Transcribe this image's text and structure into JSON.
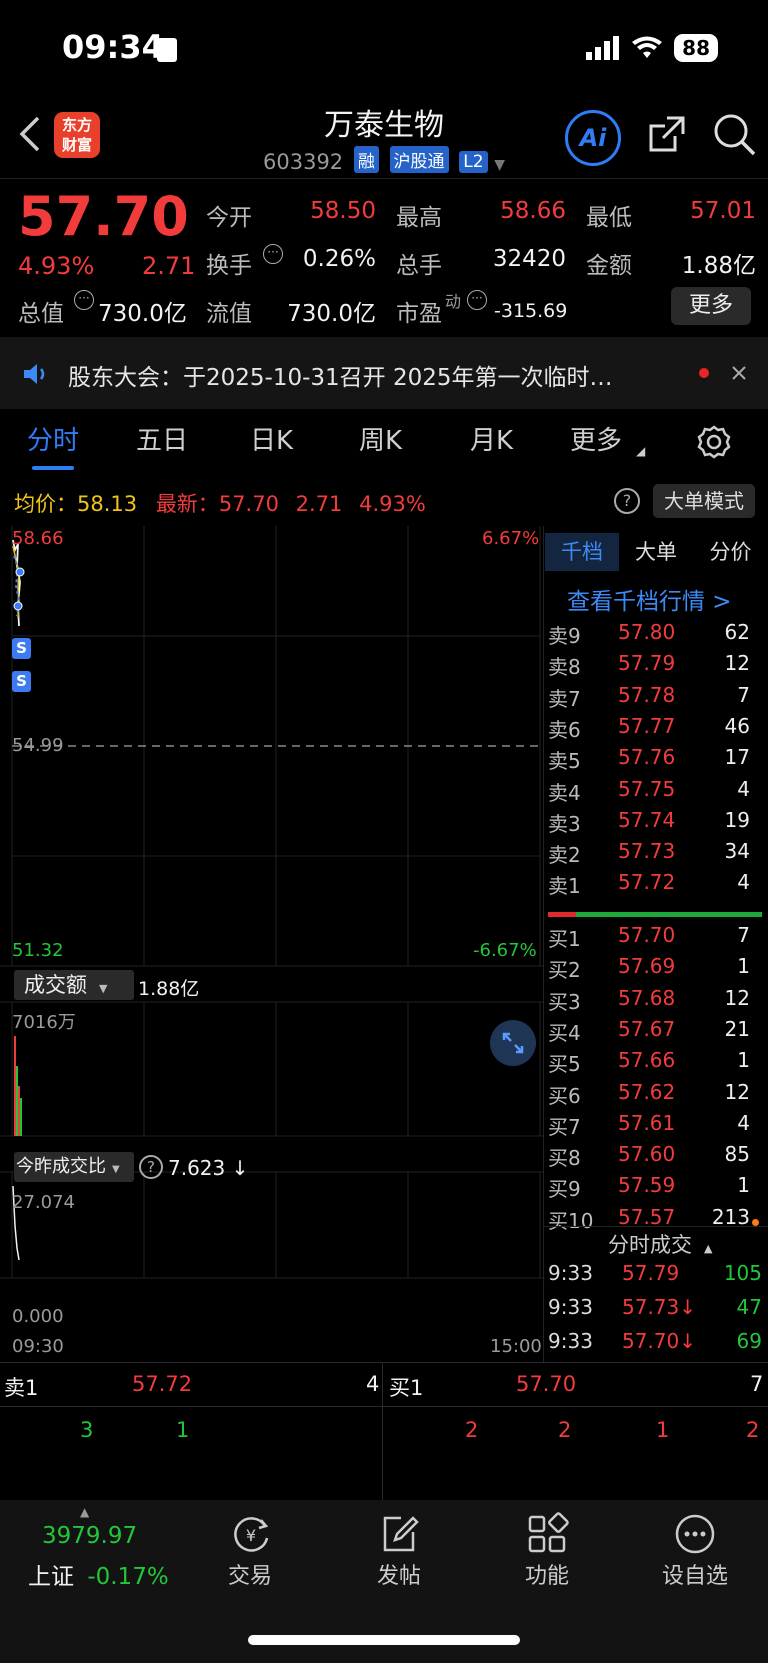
{
  "status_bar": {
    "time": "09:34",
    "battery": "88"
  },
  "header": {
    "logo_line1": "东方",
    "logo_line2": "财富",
    "title": "万泰生物",
    "code": "603392",
    "tags": [
      "融",
      "沪股通",
      "L2"
    ],
    "ai_label": "Ai"
  },
  "quote": {
    "price": "57.70",
    "change_pct": "4.93%",
    "change": "2.71",
    "open_label": "今开",
    "open": "58.50",
    "high_label": "最高",
    "high": "58.66",
    "low_label": "最低",
    "low": "57.01",
    "turnover_label": "换手",
    "turnover": "0.26%",
    "volume_label": "总手",
    "volume": "32420",
    "amount_label": "金额",
    "amount": "1.88亿",
    "mcap_label": "总值",
    "mcap": "730.0亿",
    "float_label": "流值",
    "float_cap": "730.0亿",
    "pe_label": "市盈",
    "pe_sup": "动",
    "pe": "-315.69",
    "more_label": "更多"
  },
  "notice": {
    "text": "股东大会：于2025-10-31召开 2025年第一次临时…"
  },
  "tabs": [
    "分时",
    "五日",
    "日K",
    "周K",
    "月K",
    "更多"
  ],
  "avg_row": {
    "avg_label": "均价：",
    "avg": "58.13",
    "latest_label": "最新：",
    "latest": "57.70",
    "change": "2.71",
    "change_pct": "4.93%",
    "mode_button": "大单模式"
  },
  "chart": {
    "price_top": "58.66",
    "pct_top": "6.67%",
    "price_mid": "54.99",
    "price_bottom": "51.32",
    "pct_bottom": "-6.67%",
    "amount_label": "成交额",
    "amount_total": "1.88亿",
    "amount_max": "7016万",
    "ratio_label": "今昨成交比",
    "ratio_value": "7.623 ↓",
    "ratio_max": "27.074",
    "ratio_min": "0.000",
    "time_start": "09:30",
    "time_end": "15:00",
    "marker": "S"
  },
  "orderbook": {
    "tabs": [
      "千档",
      "大单",
      "分价"
    ],
    "link": "查看千档行情 >",
    "asks": [
      {
        "name": "卖9",
        "price": "57.80",
        "vol": "62"
      },
      {
        "name": "卖8",
        "price": "57.79",
        "vol": "12"
      },
      {
        "name": "卖7",
        "price": "57.78",
        "vol": "7"
      },
      {
        "name": "卖6",
        "price": "57.77",
        "vol": "46"
      },
      {
        "name": "卖5",
        "price": "57.76",
        "vol": "17"
      },
      {
        "name": "卖4",
        "price": "57.75",
        "vol": "4"
      },
      {
        "name": "卖3",
        "price": "57.74",
        "vol": "19"
      },
      {
        "name": "卖2",
        "price": "57.73",
        "vol": "34"
      },
      {
        "name": "卖1",
        "price": "57.72",
        "vol": "4"
      }
    ],
    "bids": [
      {
        "name": "买1",
        "price": "57.70",
        "vol": "7"
      },
      {
        "name": "买2",
        "price": "57.69",
        "vol": "1"
      },
      {
        "name": "买3",
        "price": "57.68",
        "vol": "12"
      },
      {
        "name": "买4",
        "price": "57.67",
        "vol": "21"
      },
      {
        "name": "买5",
        "price": "57.66",
        "vol": "1"
      },
      {
        "name": "买6",
        "price": "57.62",
        "vol": "12"
      },
      {
        "name": "买7",
        "price": "57.61",
        "vol": "4"
      },
      {
        "name": "买8",
        "price": "57.60",
        "vol": "85"
      },
      {
        "name": "买9",
        "price": "57.59",
        "vol": "1"
      },
      {
        "name": "买10",
        "price": "57.57",
        "vol": "213"
      }
    ]
  },
  "trades": {
    "header": "分时成交",
    "rows": [
      {
        "time": "9:33",
        "price": "57.79",
        "vol": "105",
        "dir": ""
      },
      {
        "time": "9:33",
        "price": "57.73↓",
        "vol": "47",
        "dir": "down"
      },
      {
        "time": "9:33",
        "price": "57.70↓",
        "vol": "69",
        "dir": "down"
      }
    ]
  },
  "l2": {
    "sell_label": "卖1",
    "sell_price": "57.72",
    "sell_vol": "4",
    "buy_label": "买1",
    "buy_price": "57.70",
    "buy_vol": "7",
    "sell_queue": [
      "3",
      "1"
    ],
    "buy_queue": [
      "2",
      "2",
      "1",
      "2"
    ]
  },
  "bottom_nav": {
    "index_value": "3979.97",
    "index_name": "上证",
    "index_change": "-0.17%",
    "items": [
      "交易",
      "发帖",
      "功能",
      "设自选"
    ]
  },
  "colors": {
    "up": "#f23c3c",
    "down": "#22c63a",
    "accent": "#2f7cf6"
  }
}
